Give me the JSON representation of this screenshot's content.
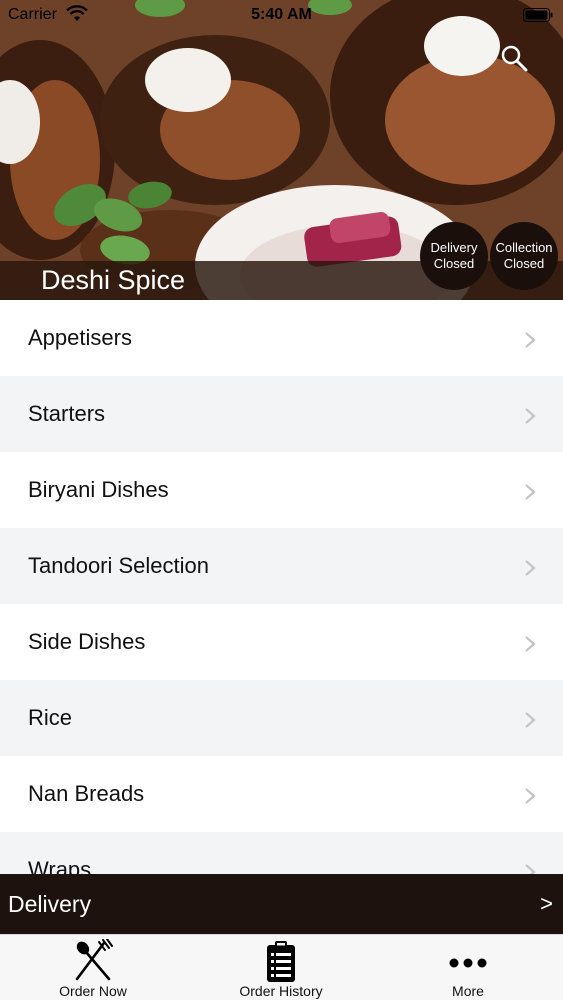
{
  "status_bar": {
    "carrier": "Carrier",
    "time": "5:40 AM"
  },
  "header": {
    "restaurant_name": "Deshi Spice",
    "delivery_status": {
      "line1": "Delivery",
      "line2": "Closed"
    },
    "collection_status": {
      "line1": "Collection",
      "line2": "Closed"
    },
    "search_icon": "search-icon"
  },
  "menu": {
    "items": [
      {
        "label": "Appetisers"
      },
      {
        "label": "Starters"
      },
      {
        "label": "Biryani Dishes"
      },
      {
        "label": "Tandoori Selection"
      },
      {
        "label": "Side Dishes"
      },
      {
        "label": "Rice"
      },
      {
        "label": "Nan Breads"
      },
      {
        "label": "Wraps"
      }
    ]
  },
  "delivery_bar": {
    "label": "Delivery",
    "arrow": ">"
  },
  "tabbar": {
    "tabs": [
      {
        "label": "Order Now",
        "icon": "fork-spoon-icon"
      },
      {
        "label": "Order History",
        "icon": "clipboard-list-icon"
      },
      {
        "label": "More",
        "icon": "more-dots-icon"
      }
    ]
  },
  "colors": {
    "header_band": "#28160c",
    "status_circle": "#1a0f0b",
    "delivery_bar": "#1d120d",
    "row_alt": "#f3f4f6",
    "tabbar_bg": "#f7f7f7"
  }
}
